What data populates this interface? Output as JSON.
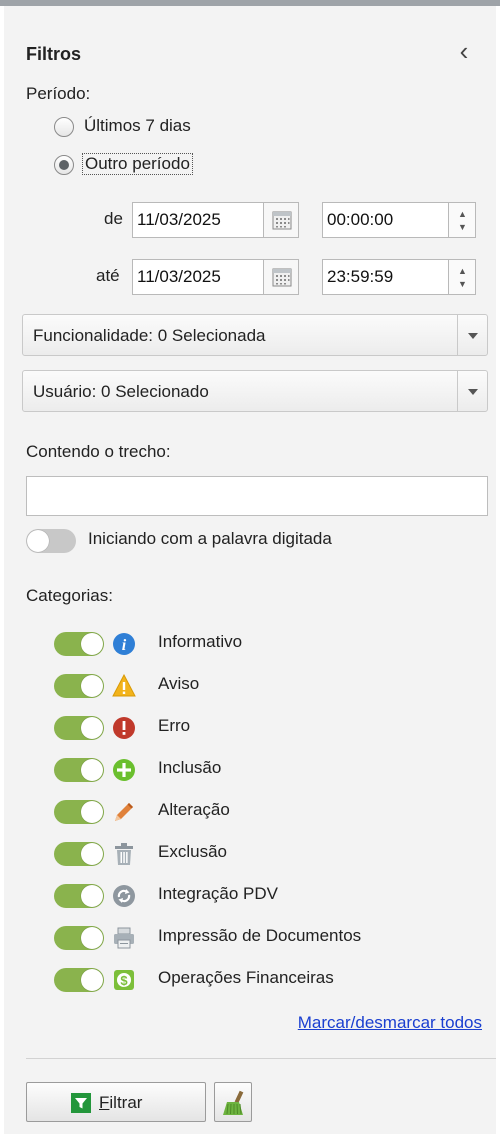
{
  "panel": {
    "title": "Filtros",
    "collapse_glyph": "‹"
  },
  "periodo": {
    "label": "Período:",
    "options": [
      {
        "label": "Últimos 7 dias",
        "selected": false
      },
      {
        "label": "Outro período",
        "selected": true
      }
    ],
    "de_label": "de",
    "ate_label": "até",
    "de_date": "11/03/2025",
    "de_time": "00:00:00",
    "ate_date": "11/03/2025",
    "ate_time": "23:59:59"
  },
  "funcionalidade": {
    "label": "Funcionalidade: 0 Selecionada"
  },
  "usuario": {
    "label": "Usuário: 0 Selecionado"
  },
  "trecho": {
    "label": "Contendo o trecho:",
    "value": "",
    "toggle_label": "Iniciando com a palavra digitada",
    "toggle_on": false
  },
  "categorias": {
    "label": "Categorias:",
    "items": [
      {
        "label": "Informativo",
        "icon": "info-icon",
        "on": true
      },
      {
        "label": "Aviso",
        "icon": "warning-icon",
        "on": true
      },
      {
        "label": "Erro",
        "icon": "error-icon",
        "on": true
      },
      {
        "label": "Inclusão",
        "icon": "plus-icon",
        "on": true
      },
      {
        "label": "Alteração",
        "icon": "pencil-icon",
        "on": true
      },
      {
        "label": "Exclusão",
        "icon": "trash-icon",
        "on": true
      },
      {
        "label": "Integração PDV",
        "icon": "sync-icon",
        "on": true
      },
      {
        "label": "Impressão de Documentos",
        "icon": "printer-icon",
        "on": true
      },
      {
        "label": "Operações Financeiras",
        "icon": "dollar-icon",
        "on": true
      }
    ]
  },
  "toggle_all_link": "Marcar/desmarcar todos",
  "buttons": {
    "filter_mnemonic": "F",
    "filter_rest": "iltrar"
  },
  "colors": {
    "toggle_on": "#8ab34d",
    "toggle_off": "#c8c8c8",
    "link": "#1a3fd0",
    "filter_icon": "#23963b"
  }
}
